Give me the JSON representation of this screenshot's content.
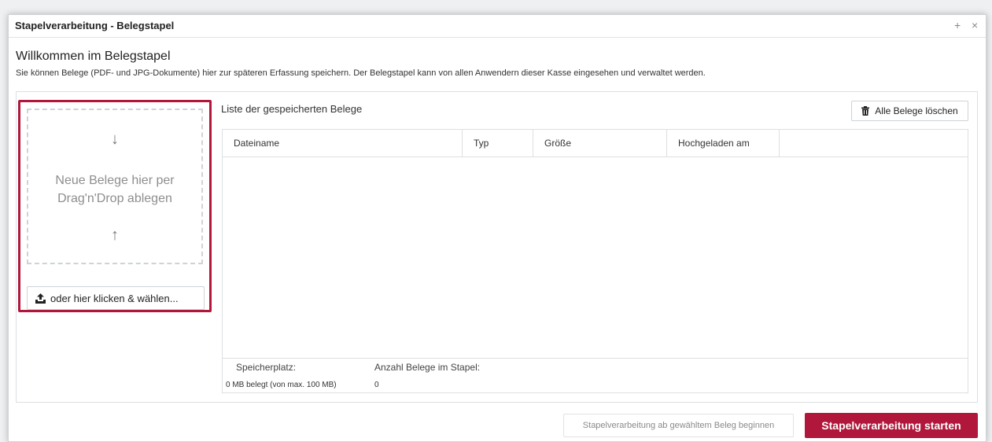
{
  "dialog": {
    "title": "Stapelverarbeitung - Belegstapel",
    "add_glyph": "+",
    "close_glyph": "×"
  },
  "welcome": {
    "title": "Willkommen im Belegstapel",
    "description": "Sie können Belege (PDF- und JPG-Dokumente) hier zur späteren Erfassung speichern. Der Belegstapel kann von allen Anwendern dieser Kasse eingesehen und verwaltet werden."
  },
  "upload": {
    "drop_line1": "Neue Belege hier per",
    "drop_line2": "Drag'n'Drop ablegen",
    "arrow_down": "↓",
    "arrow_up": "↑",
    "pick_label": "oder hier klicken & wählen..."
  },
  "list": {
    "title": "Liste der gespeicherten Belege",
    "delete_all_label": "Alle Belege löschen",
    "columns": [
      "Dateiname",
      "Typ",
      "Größe",
      "Hochgeladen am"
    ],
    "rows": []
  },
  "footer": {
    "storage_label": "Speicherplatz:",
    "storage_value": "0 MB belegt (von max. 100 MB)",
    "count_label": "Anzahl Belege im Stapel:",
    "count_value": "0"
  },
  "actions": {
    "start_from_selected": "Stapelverarbeitung ab gewähltem Beleg beginnen",
    "start": "Stapelverarbeitung starten"
  },
  "colors": {
    "accent": "#b0173b"
  }
}
